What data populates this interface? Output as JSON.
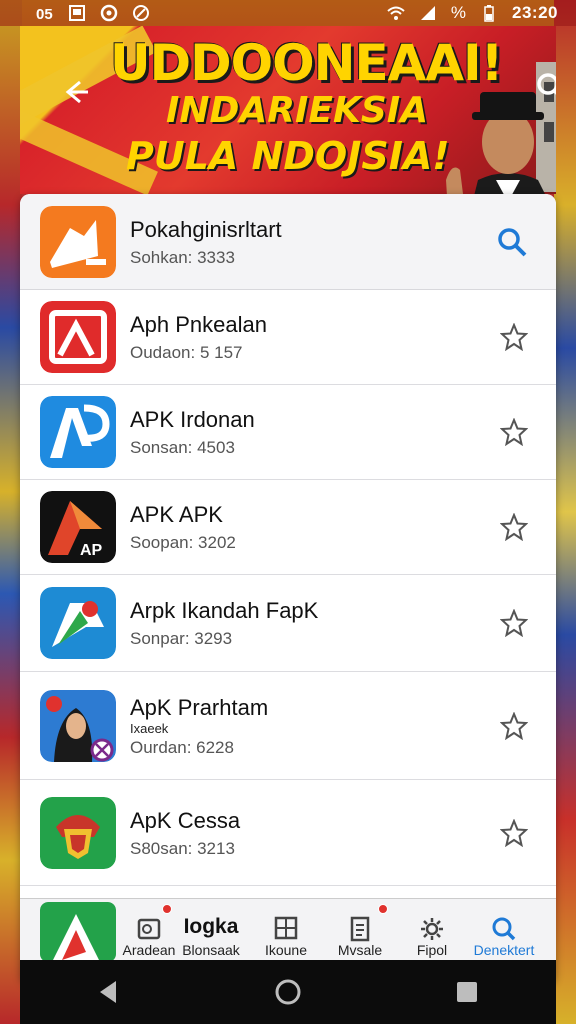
{
  "status_bar": {
    "left_icons": [
      "sim-icon",
      "photo-icon",
      "circle-app-icon",
      "link-icon"
    ],
    "time": "23:20",
    "right_icons": [
      "wifi-icon",
      "signal-icon",
      "battery-icon"
    ],
    "battery_text": "%"
  },
  "banner": {
    "line1": "UDDOONEAAI!",
    "line2": "INDARIEKSIA",
    "line3": "PULA NDOJSIA!"
  },
  "featured": {
    "title": "Pokahginisrltart",
    "subtitle": "Sohkan: 3333"
  },
  "apps": [
    {
      "title": "Aph Pnkealan",
      "subtitle": "Oudaon: 5 157",
      "extra": ""
    },
    {
      "title": "APK Irdonan",
      "subtitle": "Sonsan: 4503",
      "extra": ""
    },
    {
      "title": "APK APK",
      "subtitle": "Soopan: 3202",
      "extra": ""
    },
    {
      "title": "Arpk Ikandah FapK",
      "subtitle": "Sonpar: 3293",
      "extra": ""
    },
    {
      "title": "ApK Prarhtam",
      "subtitle": "Ourdan: 6228",
      "extra": "Ixaeek"
    },
    {
      "title": "ApK Cessa",
      "subtitle": "S80san: 3213",
      "extra": ""
    }
  ],
  "bottom_nav": {
    "big_label": "Iogka",
    "items": [
      {
        "label": "Aradean",
        "icon": "image-icon",
        "badge": true
      },
      {
        "label": "Blonsaak",
        "icon": "",
        "badge": false
      },
      {
        "label": "Ikoune",
        "icon": "grid-icon",
        "badge": false
      },
      {
        "label": "Mvsale",
        "icon": "document-icon",
        "badge": true
      },
      {
        "label": "Fipol",
        "icon": "settings-icon",
        "badge": false
      },
      {
        "label": "Denektert",
        "icon": "search-icon",
        "badge": false
      }
    ]
  },
  "colors": {
    "accent": "#1f7ad6",
    "banner_red": "#d8232a",
    "banner_yellow": "#ffd400"
  }
}
